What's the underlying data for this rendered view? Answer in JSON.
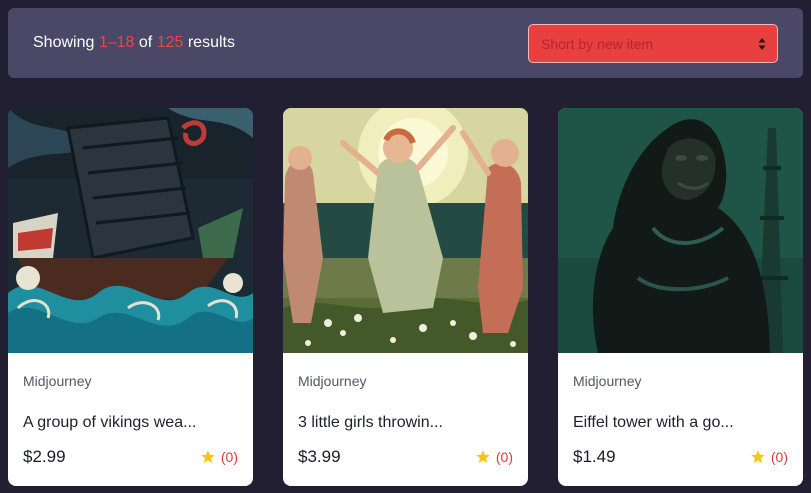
{
  "toolbar": {
    "showing_prefix": "Showing",
    "range_start": "1",
    "range_dash": "–",
    "range_end": "18",
    "of_label": "of",
    "total": "125",
    "results_label": "results",
    "sort_placeholder": "Short by new item"
  },
  "colors": {
    "page_bg": "#211f31",
    "toolbar_bg": "#4a4767",
    "accent_red": "#e83f40",
    "highlight": "#ef4348",
    "star": "#f5c518"
  },
  "products": [
    {
      "category": "Midjourney",
      "title": "A group of vikings wea...",
      "price": "$2.99",
      "rating_count": "(0)",
      "image": "vikings-ship-waves-artwork"
    },
    {
      "category": "Midjourney",
      "title": "3 little girls throwin...",
      "price": "$3.99",
      "rating_count": "(0)",
      "image": "three-girls-dancing-artwork"
    },
    {
      "category": "Midjourney",
      "title": "Eiffel tower with a go...",
      "price": "$1.49",
      "rating_count": "(0)",
      "image": "gorilla-eiffel-tower-artwork"
    }
  ]
}
